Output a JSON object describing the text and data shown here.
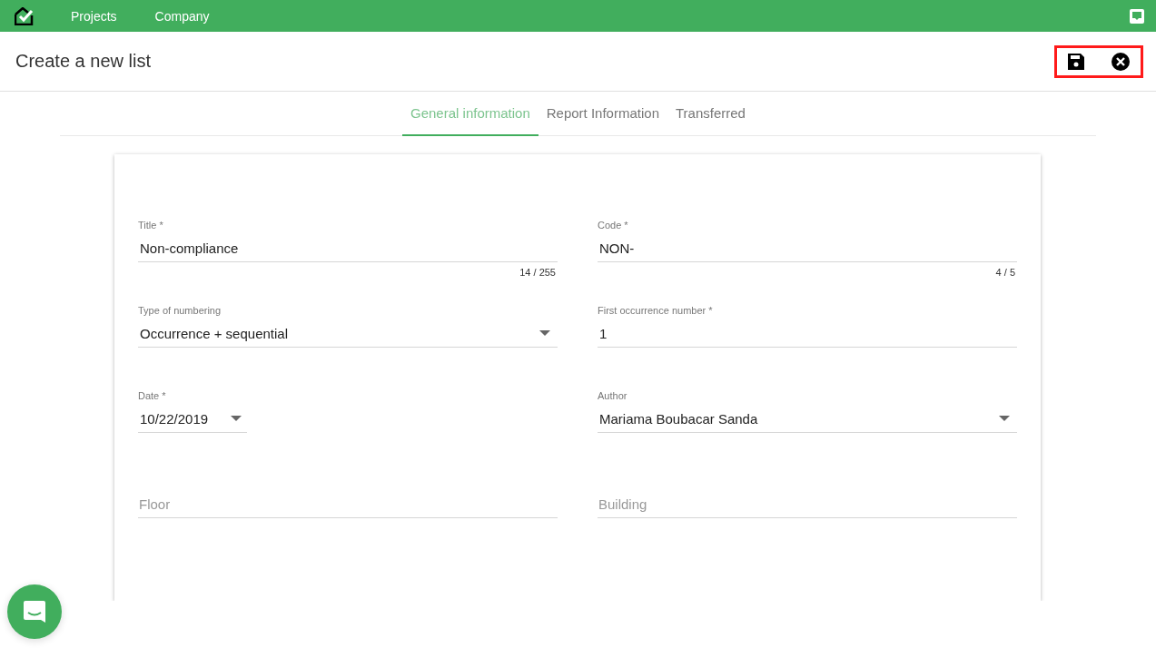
{
  "nav": {
    "items": [
      {
        "label": "Projects"
      },
      {
        "label": "Company"
      }
    ]
  },
  "page": {
    "title": "Create a new list",
    "actions": {
      "highlighted": true
    }
  },
  "tabs": [
    {
      "label": "General information",
      "selected": true
    },
    {
      "label": "Report Information",
      "selected": false
    },
    {
      "label": "Transferred",
      "selected": false
    }
  ],
  "fields": [
    {
      "kind": "text",
      "label": "Title *",
      "value": "Non-compliance",
      "counter": "14 / 255"
    },
    {
      "kind": "text",
      "label": "Code *",
      "value": "NON-",
      "counter": "4 / 5"
    },
    {
      "kind": "select",
      "label": "Type of numbering",
      "value": "Occurrence + sequential"
    },
    {
      "kind": "text",
      "label": "First occurrence number *",
      "value": "1"
    },
    {
      "kind": "date",
      "label": "Date *",
      "value": "10/22/2019"
    },
    {
      "kind": "select",
      "label": "Author",
      "value": "Mariama Boubacar Sanda"
    },
    {
      "kind": "text",
      "placeholder": "Floor"
    },
    {
      "kind": "text",
      "placeholder": "Building"
    }
  ]
}
